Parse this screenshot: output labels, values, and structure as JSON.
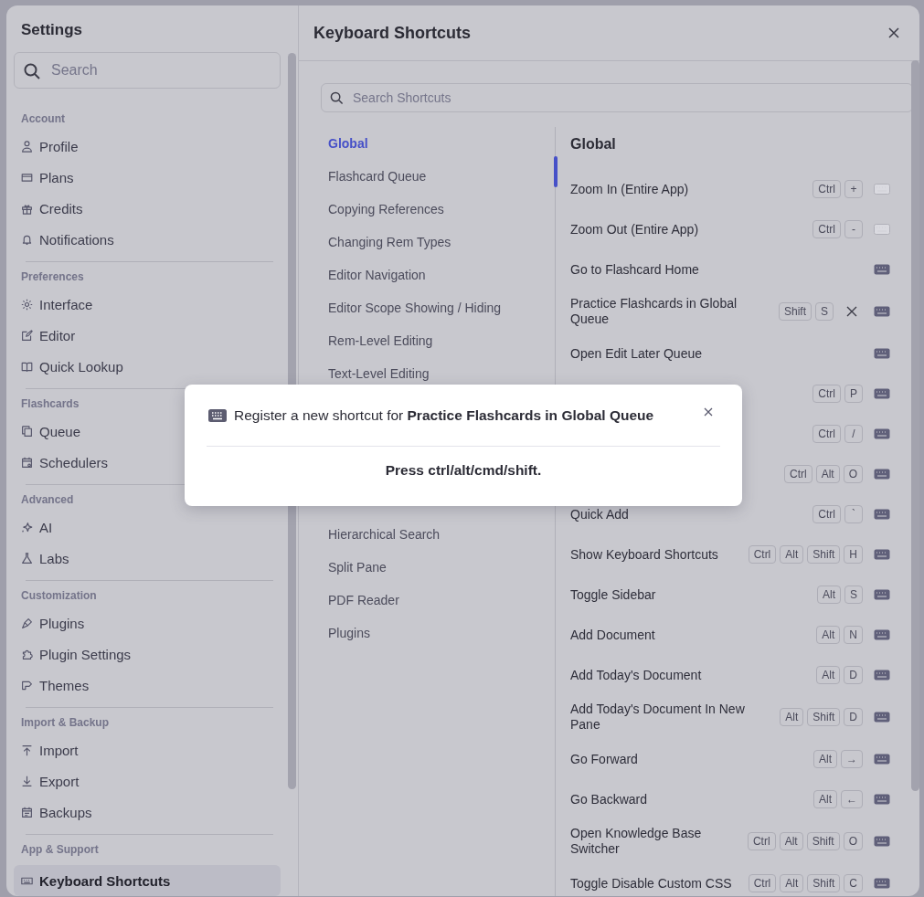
{
  "settings": {
    "title": "Settings",
    "search": {
      "placeholder": "Search"
    },
    "sections": [
      {
        "heading": "Account",
        "items": [
          {
            "label": "Profile",
            "selected": false
          },
          {
            "label": "Plans",
            "selected": false
          },
          {
            "label": "Credits",
            "selected": false
          },
          {
            "label": "Notifications",
            "selected": false
          }
        ]
      },
      {
        "heading": "Preferences",
        "items": [
          {
            "label": "Interface",
            "selected": false
          },
          {
            "label": "Editor",
            "selected": false
          },
          {
            "label": "Quick Lookup",
            "selected": false
          }
        ]
      },
      {
        "heading": "Flashcards",
        "items": [
          {
            "label": "Queue",
            "selected": false
          },
          {
            "label": "Schedulers",
            "selected": false
          }
        ]
      },
      {
        "heading": "Advanced",
        "items": [
          {
            "label": "AI",
            "selected": false
          },
          {
            "label": "Labs",
            "selected": false
          }
        ]
      },
      {
        "heading": "Customization",
        "items": [
          {
            "label": "Plugins",
            "selected": false
          },
          {
            "label": "Plugin Settings",
            "selected": false
          },
          {
            "label": "Themes",
            "selected": false
          }
        ]
      },
      {
        "heading": "Import & Backup",
        "items": [
          {
            "label": "Import",
            "selected": false
          },
          {
            "label": "Export",
            "selected": false
          },
          {
            "label": "Backups",
            "selected": false
          }
        ]
      },
      {
        "heading": "App & Support",
        "items": [
          {
            "label": "Keyboard Shortcuts",
            "selected": true
          }
        ]
      }
    ]
  },
  "page": {
    "title": "Keyboard Shortcuts",
    "search": {
      "placeholder": "Search Shortcuts"
    },
    "category_groups": [
      [
        {
          "label": "Global",
          "selected": true
        },
        {
          "label": "Flashcard Queue",
          "selected": false
        },
        {
          "label": "Copying References",
          "selected": false
        },
        {
          "label": "Changing Rem Types",
          "selected": false
        },
        {
          "label": "Editor Navigation",
          "selected": false
        },
        {
          "label": "Editor Scope Showing / Hiding",
          "selected": false
        },
        {
          "label": "Rem-Level Editing",
          "selected": false
        },
        {
          "label": "Text-Level Editing",
          "selected": false
        }
      ],
      [
        {
          "label": "Hierarchical Search",
          "selected": false
        },
        {
          "label": "Split Pane",
          "selected": false
        },
        {
          "label": "PDF Reader",
          "selected": false
        },
        {
          "label": "Plugins",
          "selected": false
        }
      ]
    ],
    "group_title": "Global",
    "shortcuts": [
      {
        "label": "Zoom In (Entire App)",
        "keys": [
          "Ctrl",
          "+"
        ],
        "clearable": false,
        "editable": false
      },
      {
        "label": "Zoom Out (Entire App)",
        "keys": [
          "Ctrl",
          "-"
        ],
        "clearable": false,
        "editable": false
      },
      {
        "label": "Go to Flashcard Home",
        "clearable": false,
        "editable": true
      },
      {
        "label": "Practice Flashcards in Global Queue",
        "keys": [
          "Shift",
          "S"
        ],
        "clearable": true,
        "editable": true
      },
      {
        "label": "Open Edit Later Queue",
        "clearable": false,
        "editable": true
      },
      {
        "keys": [
          "Ctrl",
          "P"
        ],
        "clearable": false,
        "editable": true
      },
      {
        "keys": [
          "Ctrl",
          "/"
        ],
        "clearable": false,
        "editable": true
      },
      {
        "keys": [
          "Ctrl",
          "Alt",
          "O"
        ],
        "clearable": false,
        "editable": true
      },
      {
        "label": "Quick Add",
        "keys": [
          "Ctrl",
          "`"
        ],
        "clearable": false,
        "editable": true
      },
      {
        "label": "Show Keyboard Shortcuts",
        "keys": [
          "Ctrl",
          "Alt",
          "Shift",
          "H"
        ],
        "clearable": false,
        "editable": true
      },
      {
        "label": "Toggle Sidebar",
        "keys": [
          "Alt",
          "S"
        ],
        "clearable": false,
        "editable": true
      },
      {
        "label": "Add Document",
        "keys": [
          "Alt",
          "N"
        ],
        "clearable": false,
        "editable": true
      },
      {
        "label": "Add Today's Document",
        "keys": [
          "Alt",
          "D"
        ],
        "clearable": false,
        "editable": true
      },
      {
        "label": "Add Today's Document In New Pane",
        "keys": [
          "Alt",
          "Shift",
          "D"
        ],
        "clearable": false,
        "editable": true
      },
      {
        "label": "Go Forward",
        "keys": [
          "Alt",
          "→"
        ],
        "clearable": false,
        "editable": true
      },
      {
        "label": "Go Backward",
        "keys": [
          "Alt",
          "←"
        ],
        "clearable": false,
        "editable": true
      },
      {
        "label": "Open Knowledge Base Switcher",
        "keys": [
          "Ctrl",
          "Alt",
          "Shift",
          "O"
        ],
        "clearable": false,
        "editable": true
      },
      {
        "label": "Toggle Disable Custom CSS",
        "keys": [
          "Ctrl",
          "Alt",
          "Shift",
          "C"
        ],
        "clearable": false,
        "editable": true
      }
    ]
  },
  "dialog": {
    "message": "Register a new shortcut for **Practice Flashcards in Global Queue**",
    "prompt": "Press ctrl/alt/cmd/shift."
  }
}
